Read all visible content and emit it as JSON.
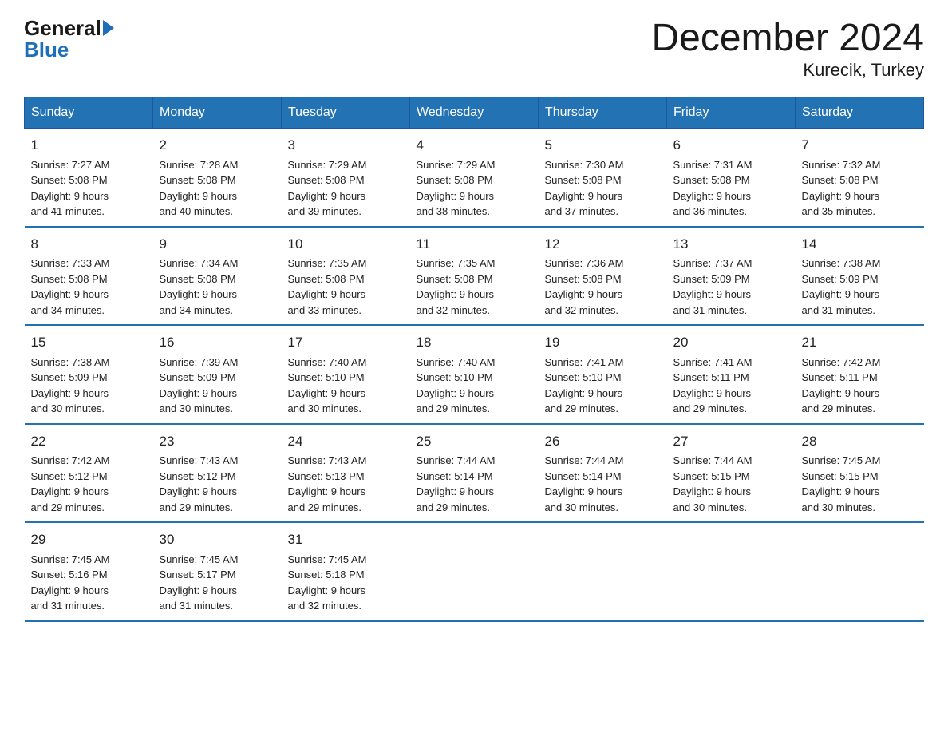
{
  "logo": {
    "general": "General",
    "arrow": "",
    "blue": "Blue"
  },
  "title": "December 2024",
  "subtitle": "Kurecik, Turkey",
  "days_of_week": [
    "Sunday",
    "Monday",
    "Tuesday",
    "Wednesday",
    "Thursday",
    "Friday",
    "Saturday"
  ],
  "weeks": [
    [
      {
        "day": "1",
        "sunrise": "7:27 AM",
        "sunset": "5:08 PM",
        "daylight": "9 hours and 41 minutes."
      },
      {
        "day": "2",
        "sunrise": "7:28 AM",
        "sunset": "5:08 PM",
        "daylight": "9 hours and 40 minutes."
      },
      {
        "day": "3",
        "sunrise": "7:29 AM",
        "sunset": "5:08 PM",
        "daylight": "9 hours and 39 minutes."
      },
      {
        "day": "4",
        "sunrise": "7:29 AM",
        "sunset": "5:08 PM",
        "daylight": "9 hours and 38 minutes."
      },
      {
        "day": "5",
        "sunrise": "7:30 AM",
        "sunset": "5:08 PM",
        "daylight": "9 hours and 37 minutes."
      },
      {
        "day": "6",
        "sunrise": "7:31 AM",
        "sunset": "5:08 PM",
        "daylight": "9 hours and 36 minutes."
      },
      {
        "day": "7",
        "sunrise": "7:32 AM",
        "sunset": "5:08 PM",
        "daylight": "9 hours and 35 minutes."
      }
    ],
    [
      {
        "day": "8",
        "sunrise": "7:33 AM",
        "sunset": "5:08 PM",
        "daylight": "9 hours and 34 minutes."
      },
      {
        "day": "9",
        "sunrise": "7:34 AM",
        "sunset": "5:08 PM",
        "daylight": "9 hours and 34 minutes."
      },
      {
        "day": "10",
        "sunrise": "7:35 AM",
        "sunset": "5:08 PM",
        "daylight": "9 hours and 33 minutes."
      },
      {
        "day": "11",
        "sunrise": "7:35 AM",
        "sunset": "5:08 PM",
        "daylight": "9 hours and 32 minutes."
      },
      {
        "day": "12",
        "sunrise": "7:36 AM",
        "sunset": "5:08 PM",
        "daylight": "9 hours and 32 minutes."
      },
      {
        "day": "13",
        "sunrise": "7:37 AM",
        "sunset": "5:09 PM",
        "daylight": "9 hours and 31 minutes."
      },
      {
        "day": "14",
        "sunrise": "7:38 AM",
        "sunset": "5:09 PM",
        "daylight": "9 hours and 31 minutes."
      }
    ],
    [
      {
        "day": "15",
        "sunrise": "7:38 AM",
        "sunset": "5:09 PM",
        "daylight": "9 hours and 30 minutes."
      },
      {
        "day": "16",
        "sunrise": "7:39 AM",
        "sunset": "5:09 PM",
        "daylight": "9 hours and 30 minutes."
      },
      {
        "day": "17",
        "sunrise": "7:40 AM",
        "sunset": "5:10 PM",
        "daylight": "9 hours and 30 minutes."
      },
      {
        "day": "18",
        "sunrise": "7:40 AM",
        "sunset": "5:10 PM",
        "daylight": "9 hours and 29 minutes."
      },
      {
        "day": "19",
        "sunrise": "7:41 AM",
        "sunset": "5:10 PM",
        "daylight": "9 hours and 29 minutes."
      },
      {
        "day": "20",
        "sunrise": "7:41 AM",
        "sunset": "5:11 PM",
        "daylight": "9 hours and 29 minutes."
      },
      {
        "day": "21",
        "sunrise": "7:42 AM",
        "sunset": "5:11 PM",
        "daylight": "9 hours and 29 minutes."
      }
    ],
    [
      {
        "day": "22",
        "sunrise": "7:42 AM",
        "sunset": "5:12 PM",
        "daylight": "9 hours and 29 minutes."
      },
      {
        "day": "23",
        "sunrise": "7:43 AM",
        "sunset": "5:12 PM",
        "daylight": "9 hours and 29 minutes."
      },
      {
        "day": "24",
        "sunrise": "7:43 AM",
        "sunset": "5:13 PM",
        "daylight": "9 hours and 29 minutes."
      },
      {
        "day": "25",
        "sunrise": "7:44 AM",
        "sunset": "5:14 PM",
        "daylight": "9 hours and 29 minutes."
      },
      {
        "day": "26",
        "sunrise": "7:44 AM",
        "sunset": "5:14 PM",
        "daylight": "9 hours and 30 minutes."
      },
      {
        "day": "27",
        "sunrise": "7:44 AM",
        "sunset": "5:15 PM",
        "daylight": "9 hours and 30 minutes."
      },
      {
        "day": "28",
        "sunrise": "7:45 AM",
        "sunset": "5:15 PM",
        "daylight": "9 hours and 30 minutes."
      }
    ],
    [
      {
        "day": "29",
        "sunrise": "7:45 AM",
        "sunset": "5:16 PM",
        "daylight": "9 hours and 31 minutes."
      },
      {
        "day": "30",
        "sunrise": "7:45 AM",
        "sunset": "5:17 PM",
        "daylight": "9 hours and 31 minutes."
      },
      {
        "day": "31",
        "sunrise": "7:45 AM",
        "sunset": "5:18 PM",
        "daylight": "9 hours and 32 minutes."
      },
      null,
      null,
      null,
      null
    ]
  ]
}
